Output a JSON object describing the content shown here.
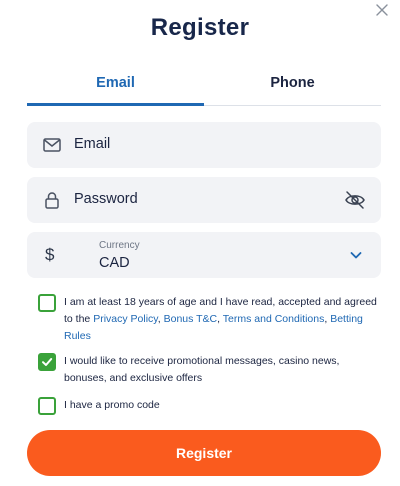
{
  "title": "Register",
  "tabs": [
    {
      "label": "Email",
      "active": true
    },
    {
      "label": "Phone",
      "active": false
    }
  ],
  "fields": {
    "email": {
      "placeholder": "Email",
      "icon": "mail-icon"
    },
    "password": {
      "placeholder": "Password",
      "icon": "lock-icon",
      "toggle_icon": "eye-off-icon"
    },
    "currency": {
      "label": "Currency",
      "value": "CAD",
      "symbol": "$"
    }
  },
  "checkboxes": {
    "age": {
      "checked": false,
      "text_start": "I am at least 18 years of age and I have read, accepted and agreed to the ",
      "link_privacy": "Privacy Policy",
      "sep1": ", ",
      "link_bonus": "Bonus T&C",
      "sep2": ", ",
      "link_terms": "Terms and Conditions",
      "sep3": ", ",
      "link_betting": "Betting Rules"
    },
    "promo_messages": {
      "checked": true,
      "text": "I would like to receive promotional messages, casino news, bonuses, and exclusive offers"
    },
    "promo_code": {
      "checked": false,
      "text": "I have a promo code"
    }
  },
  "submit_label": "Register",
  "colors": {
    "accent": "#1f68b3",
    "button": "#fa5b1e",
    "check": "#3aa23a",
    "title": "#18274a"
  }
}
